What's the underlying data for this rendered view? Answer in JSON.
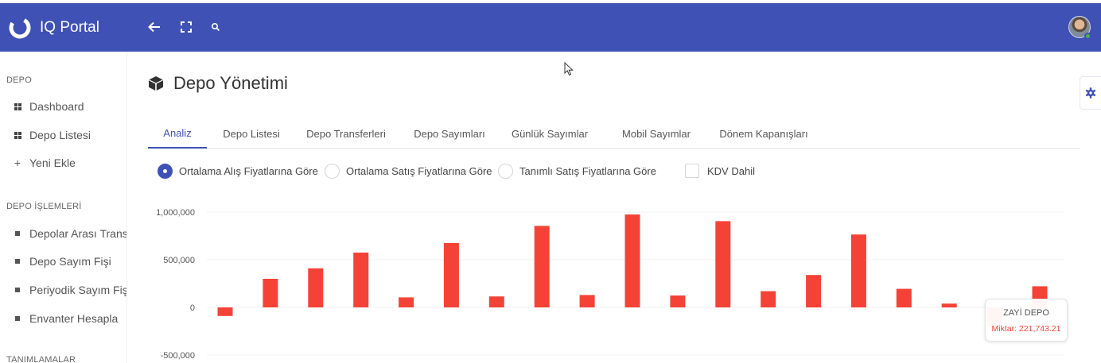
{
  "app": {
    "name": "IQ Portal"
  },
  "topbar": {
    "icons": [
      "arrow-left-icon",
      "fullscreen-icon",
      "search-icon"
    ],
    "user": "avatar"
  },
  "sidebar": {
    "sections": [
      {
        "title": "DEPO",
        "items": [
          {
            "label": "Dashboard",
            "icon": "dashboard-icon"
          },
          {
            "label": "Depo Listesi",
            "icon": "dashboard-icon"
          },
          {
            "label": "Yeni Ekle",
            "icon": "plus-icon"
          }
        ]
      },
      {
        "title": "DEPO İŞLEMLERİ",
        "items": [
          {
            "label": "Depolar Arası Transfe",
            "icon": "square-bullet-icon"
          },
          {
            "label": "Depo Sayım Fişi",
            "icon": "square-bullet-icon"
          },
          {
            "label": "Periyodik Sayım Fişi",
            "icon": "square-bullet-icon"
          },
          {
            "label": "Envanter Hesapla",
            "icon": "square-bullet-icon"
          }
        ]
      },
      {
        "title": "TANIMLAMALAR",
        "items": []
      }
    ]
  },
  "page": {
    "title": "Depo Yönetimi",
    "title_icon": "cube-icon",
    "tabs": [
      {
        "label": "Analiz",
        "active": true
      },
      {
        "label": "Depo Listesi"
      },
      {
        "label": "Depo Transferleri"
      },
      {
        "label": "Depo Sayımları"
      },
      {
        "label": "Günlük Sayımlar"
      },
      {
        "label": "Mobil Sayımlar"
      },
      {
        "label": "Dönem Kapanışları"
      }
    ],
    "options": {
      "radios": [
        {
          "label": "Ortalama Alış Fiyatlarına Göre",
          "selected": true
        },
        {
          "label": "Ortalama Satış Fiyatlarına Göre",
          "selected": false
        },
        {
          "label": "Tanımlı Satış Fiyatlarına Göre",
          "selected": false
        }
      ],
      "checkbox": {
        "label": "KDV Dahil",
        "checked": false
      }
    }
  },
  "colors": {
    "primary": "#3f51b5",
    "bar": "#f44336",
    "status_online": "#4caf50"
  },
  "chart_data": {
    "type": "bar",
    "yticks": [
      "1,000,000",
      "500,000",
      "0",
      "-500,000"
    ],
    "ylim": [
      -500000,
      1000000
    ],
    "grid": true,
    "values": [
      -90000,
      300000,
      410000,
      575000,
      105000,
      675000,
      115000,
      855000,
      130000,
      975000,
      125000,
      905000,
      170000,
      340000,
      765000,
      195000,
      40000,
      -200000,
      221743.21
    ],
    "tooltip": {
      "title": "ZAYİ DEPO",
      "value_text": "Miktar: 221,743.21"
    }
  }
}
